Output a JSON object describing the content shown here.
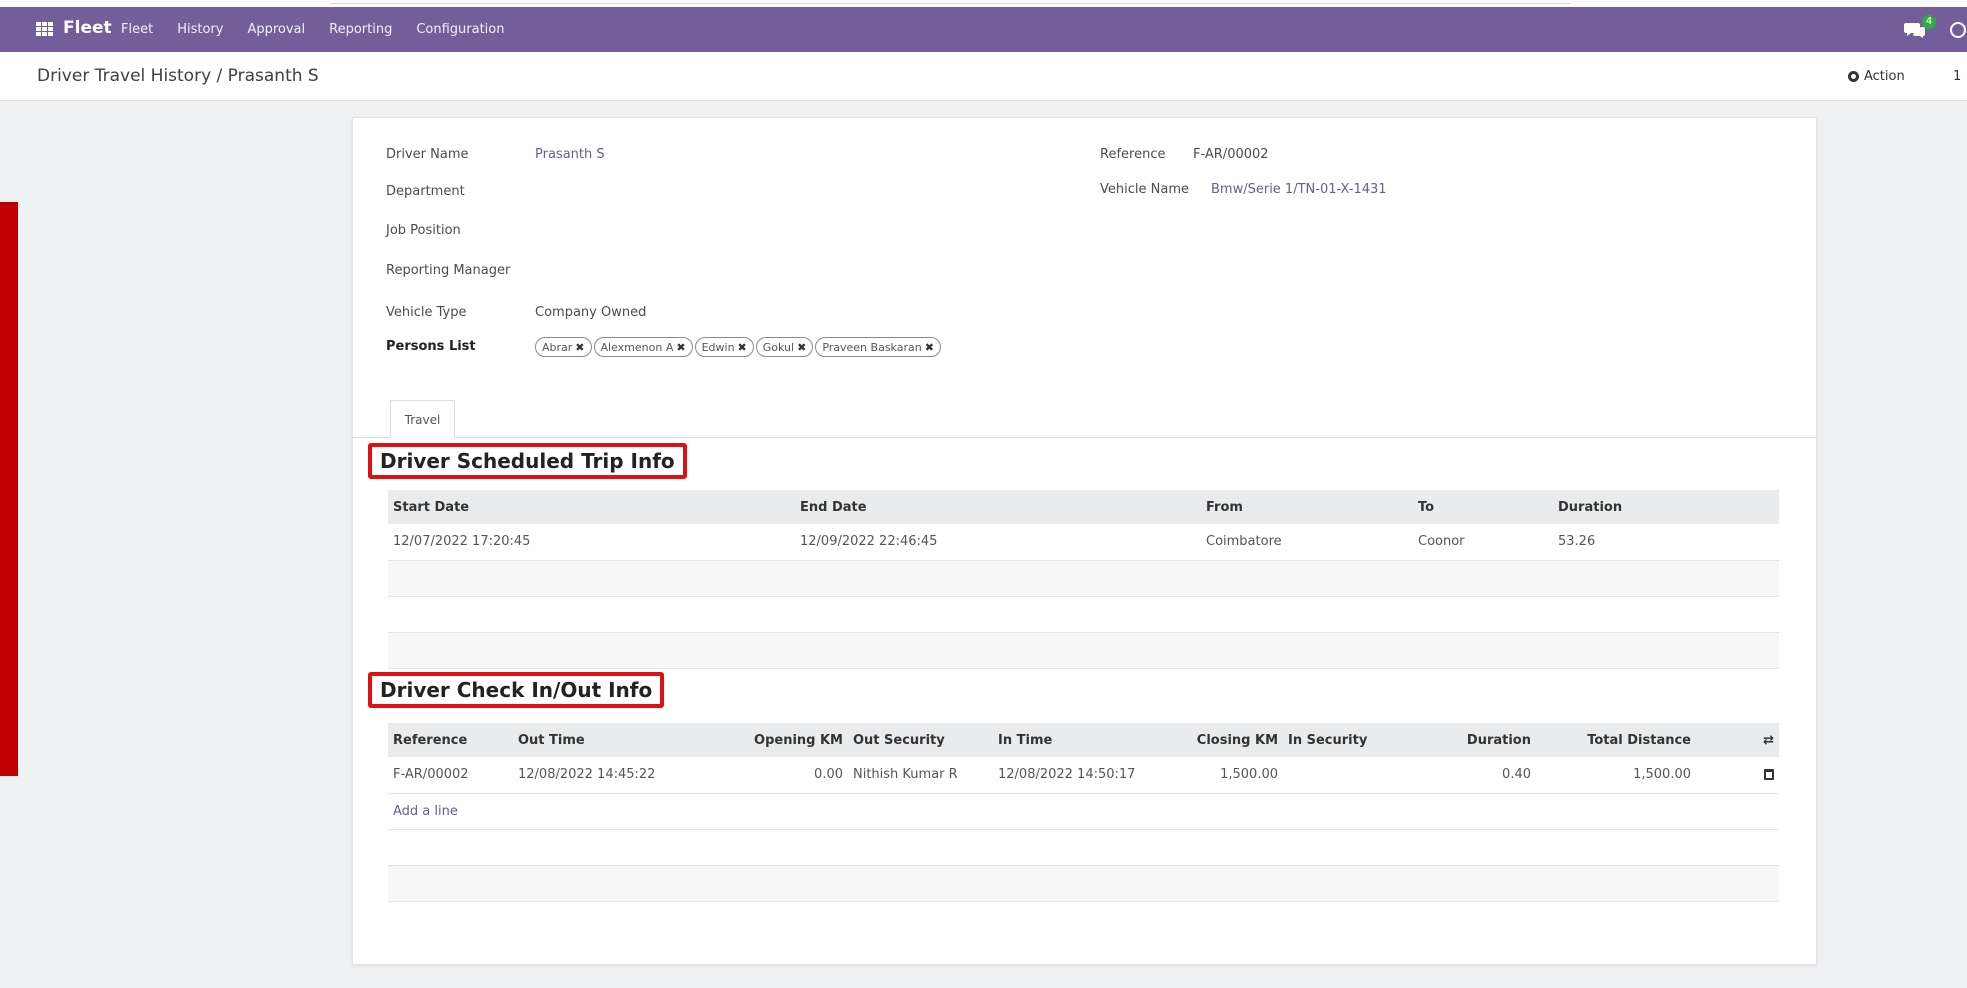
{
  "navbar": {
    "brand": "Fleet",
    "menu": [
      "Fleet",
      "History",
      "Approval",
      "Reporting",
      "Configuration"
    ],
    "chat_count": "4"
  },
  "control": {
    "breadcrumb": "Driver Travel History / Prasanth S",
    "action_label": "Action",
    "pager": "1"
  },
  "form": {
    "driver_name_label": "Driver Name",
    "driver_name": "Prasanth S",
    "department_label": "Department",
    "job_position_label": "Job Position",
    "reporting_manager_label": "Reporting Manager",
    "vehicle_type_label": "Vehicle Type",
    "vehicle_type": "Company Owned",
    "persons_list_label": "Persons List",
    "persons": [
      "Abrar",
      "Alexmenon A",
      "Edwin",
      "Gokul",
      "Praveen Baskaran"
    ],
    "reference_label": "Reference",
    "reference": "F-AR/00002",
    "vehicle_name_label": "Vehicle Name",
    "vehicle_name": "Bmw/Serie 1/TN-01-X-1431"
  },
  "tabs": {
    "travel": "Travel"
  },
  "trip": {
    "title": "Driver Scheduled Trip Info",
    "headers": [
      "Start Date",
      "End Date",
      "From",
      "To",
      "Duration"
    ],
    "rows": [
      [
        "12/07/2022 17:20:45",
        "12/09/2022 22:46:45",
        "Coimbatore",
        "Coonor",
        "53.26"
      ]
    ]
  },
  "checkinout": {
    "title": "Driver Check In/Out Info",
    "headers": [
      "Reference",
      "Out Time",
      "Opening KM",
      "Out Security",
      "In Time",
      "Closing KM",
      "In Security",
      "Duration",
      "Total Distance"
    ],
    "rows": [
      [
        "F-AR/00002",
        "12/08/2022 14:45:22",
        "0.00",
        "Nithish Kumar R",
        "12/08/2022 14:50:17",
        "1,500.00",
        "",
        "0.40",
        "1,500.00"
      ]
    ],
    "add_line": "Add a line"
  },
  "colors": {
    "navbar": "#735e9a",
    "highlight": "#e01010",
    "side_bar": "#c00000"
  }
}
